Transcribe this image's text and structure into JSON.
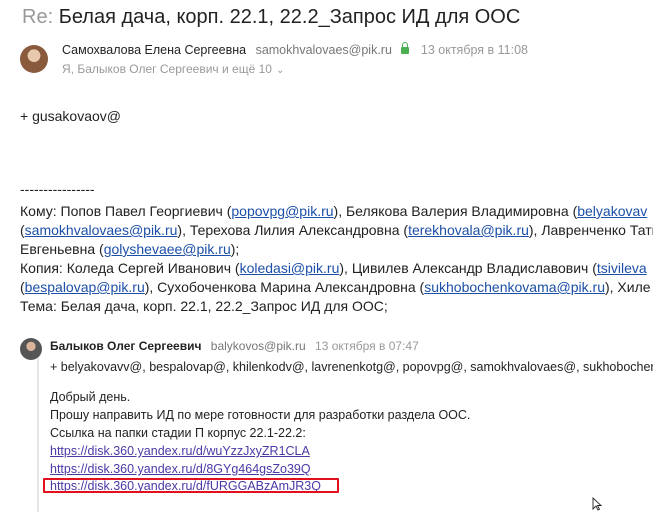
{
  "subject": {
    "prefix": "Re:",
    "title": "Белая дача, корп. 22.1, 22.2_Запрос ИД для ООС"
  },
  "sender": {
    "name": "Самохвалова Елена Сергеевна",
    "email": "samokhvalovaes@pik.ru",
    "date": "13 октября в 11:08",
    "recipients": "Я, Балыков Олег Сергеевич и ещё 10"
  },
  "body": {
    "line1": "+ gusakovaov@",
    "separator": "----------------",
    "to_line1": {
      "a": "Кому: Попов Павел Георгиевич (",
      "l1": "popovpg@pik.ru",
      "b": "), Белякова Валерия Владимировна (",
      "l2": "belyakovav"
    },
    "to_line2": {
      "a": "(",
      "l1": "samokhvalovaes@pik.ru",
      "b": "), Терехова Лилия Александровна (",
      "l2": "terekhovala@pik.ru",
      "c": "), Лавренченко Тать"
    },
    "to_line3": {
      "a": "Евгеньевна (",
      "l1": "golyshevaee@pik.ru",
      "b": ");"
    },
    "cc_line1": {
      "a": "Копия: Коледа Сергей Иванович (",
      "l1": "koledasi@pik.ru",
      "b": "), Цивилев Александр Владиславович (",
      "l2": "tsivileva"
    },
    "cc_line2": {
      "a": "(",
      "l1": "bespalovap@pik.ru",
      "b": "), Сухобоченкова Марина Александровна (",
      "l2": "sukhobochenkovama@pik.ru",
      "c": "), Хиле"
    },
    "subject_line": "Тема: Белая дача, корп. 22.1, 22.2_Запрос ИД для ООС;"
  },
  "quoted": {
    "name": "Балыков Олег Сергеевич",
    "email": "balykovos@pik.ru",
    "date": "13 октября в 07:47",
    "cc": "+ belyakovavv@, bespalovap@, khilenkodv@, lavrenenkotg@, popovpg@, samokhvalovaes@, sukhobochenk",
    "greeting": "Добрый день.",
    "request": "Прошу направить ИД по мере готовности для разработки раздела ООС.",
    "links_intro": "Ссылка на папки стадии П корпус 22.1-22.2:",
    "link1": "https://disk.360.yandex.ru/d/wuYzzJxyZR1CLA",
    "link2": "https://disk.360.yandex.ru/d/8GYg464gsZo39Q",
    "link3": "https://disk.360.yandex.ru/d/fURGGABzAmJR3Q"
  },
  "colors": {
    "highlight": "#e0101e",
    "link": "#1c4fa8"
  }
}
